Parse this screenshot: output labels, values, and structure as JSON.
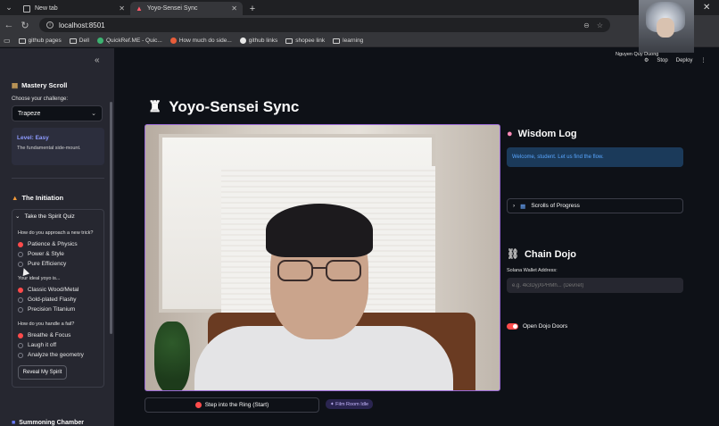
{
  "browser": {
    "tabs": [
      {
        "title": "New tab",
        "active": false
      },
      {
        "title": "Yoyo-Sensei Sync",
        "active": true
      }
    ],
    "url": "localhost:8501",
    "bookmarks": [
      {
        "label": "github pages",
        "icon": "folder-icon"
      },
      {
        "label": "Dell",
        "icon": "folder-icon"
      },
      {
        "label": "QuickRef.ME - Quic...",
        "icon": "quickref-icon"
      },
      {
        "label": "How much do side...",
        "icon": "site-icon"
      },
      {
        "label": "github links",
        "icon": "github-icon"
      },
      {
        "label": "shopee link",
        "icon": "folder-icon"
      },
      {
        "label": "learning",
        "icon": "folder-icon"
      }
    ]
  },
  "overlay": {
    "participant_name": "Nguyen Quy Duong",
    "stop_label": "Stop",
    "deploy_label": "Deploy"
  },
  "sidebar": {
    "mastery_title": "Mastery Scroll",
    "challenge_label": "Choose your challenge:",
    "challenge_value": "Trapeze",
    "level_title": "Level: Easy",
    "level_desc": "The fundamental side-mount.",
    "initiation_title": "The Initiation",
    "quiz_title": "Take the Spirit Quiz",
    "questions": [
      {
        "label": "How do you approach a new trick?",
        "options": [
          "Patience & Physics",
          "Power & Style",
          "Pure Efficiency"
        ],
        "selected": 0
      },
      {
        "label": "Your ideal yoyo is...",
        "options": [
          "Classic Wood/Metal",
          "Gold-plated Flashy",
          "Precision Titanium"
        ],
        "selected": 0
      },
      {
        "label": "How do you handle a fail?",
        "options": [
          "Breathe & Focus",
          "Laugh it off",
          "Analyze the geometry"
        ],
        "selected": 0
      }
    ],
    "reveal_button": "Reveal My Spirit",
    "next_section": "Summoning Chamber"
  },
  "main": {
    "title": "Yoyo-Sensei Sync",
    "ring_button": "Step into the Ring (Start)",
    "film_badge": "✦ Film Room Idle",
    "wisdom_title": "Wisdom Log",
    "welcome_msg": "Welcome, student. Let us find the flow.",
    "scrolls_label": "Scrolls of Progress",
    "chain_title": "Chain Dojo",
    "wallet_label": "Solana Wallet Address:",
    "wallet_placeholder": "e.g. 4k3DyjXPHMh... (Devnet)",
    "toggle_label": "Open Dojo Doors"
  },
  "colors": {
    "accent": "#ff4b4b",
    "info": "#58a6ff",
    "level": "#8e9bff",
    "frame": "#9b6ad6"
  }
}
